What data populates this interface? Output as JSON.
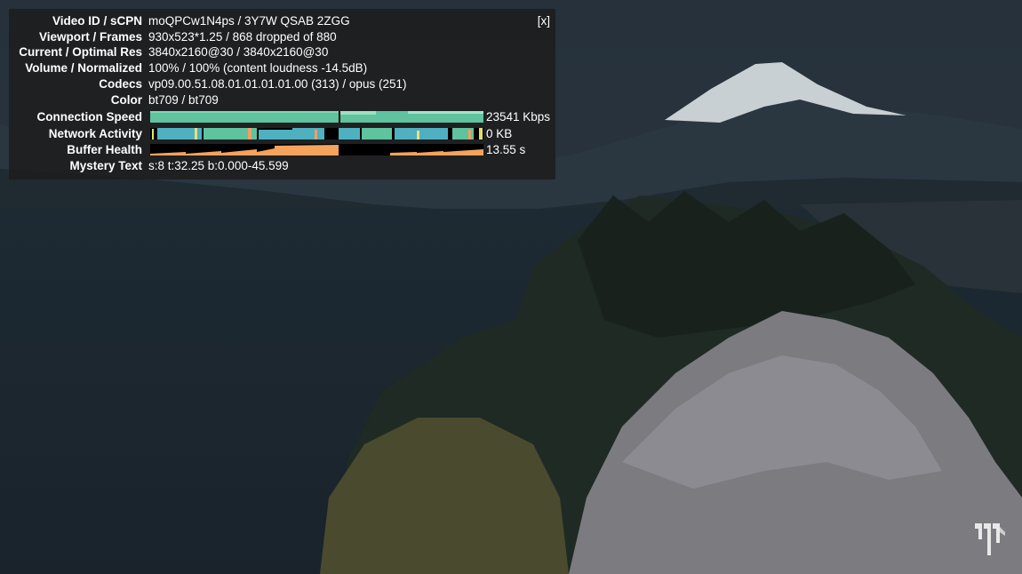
{
  "stats_panel": {
    "close_label": "[x]",
    "rows": {
      "video_id": {
        "label": "Video ID / sCPN",
        "value": "moQPCw1N4ps / 3Y7W QSAB 2ZGG"
      },
      "viewport": {
        "label": "Viewport / Frames",
        "value": "930x523*1.25 / 868 dropped of 880"
      },
      "resolution": {
        "label": "Current / Optimal Res",
        "value": "3840x2160@30 / 3840x2160@30"
      },
      "volume": {
        "label": "Volume / Normalized",
        "value": "100% / 100% (content loudness -14.5dB)"
      },
      "codecs": {
        "label": "Codecs",
        "value": "vp09.00.51.08.01.01.01.01.00 (313) / opus (251)"
      },
      "color": {
        "label": "Color",
        "value": "bt709 / bt709"
      },
      "connection": {
        "label": "Connection Speed",
        "value": "23541 Kbps"
      },
      "network": {
        "label": "Network Activity",
        "value": "0 KB"
      },
      "buffer": {
        "label": "Buffer Health",
        "value": "13.55 s"
      },
      "mystery": {
        "label": "Mystery Text",
        "value": "s:8 t:32.25 b:0.000-45.599"
      }
    }
  },
  "colors": {
    "panel_bg": "#1c1c1c",
    "connection_bar": "#5fc3a0",
    "network_bar": "#4fb0c0",
    "buffer_bar": "#f5a25d"
  },
  "icons": {
    "watermark": "channel-branding-icon"
  }
}
